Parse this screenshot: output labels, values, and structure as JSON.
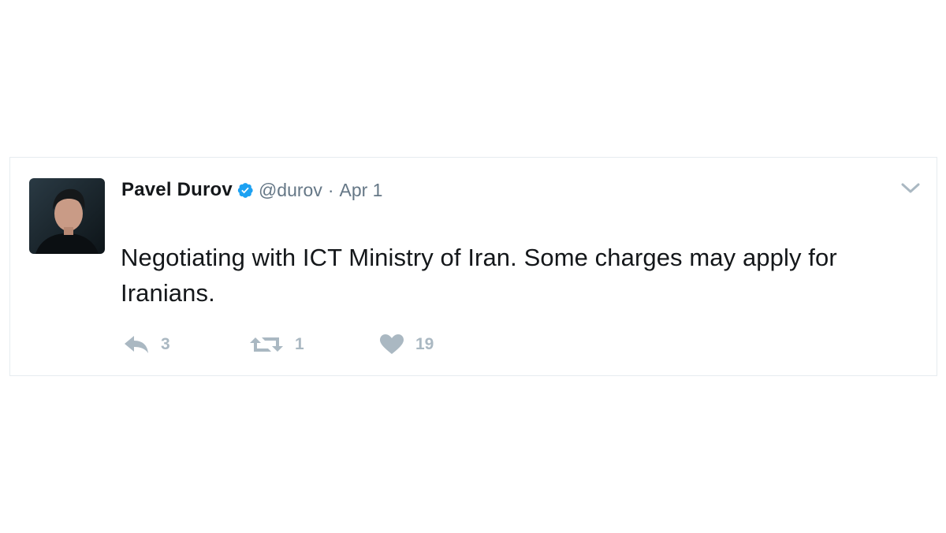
{
  "tweet": {
    "author_name": "Pavel Durov",
    "handle": "@durov",
    "separator": "·",
    "date": "Apr 1",
    "verified": true,
    "text": "Negotiating with ICT Ministry of Iran. Some charges may apply for Iranians.",
    "actions": {
      "reply_count": "3",
      "retweet_count": "1",
      "like_count": "19"
    }
  },
  "icons": {
    "verified": "verified-badge-icon",
    "menu": "chevron-down-icon",
    "reply": "reply-icon",
    "retweet": "retweet-icon",
    "like": "heart-icon"
  },
  "colors": {
    "verified_blue": "#1da1f2",
    "action_gray": "#aab8c2",
    "secondary_text": "#657786",
    "border": "#e6ecf0"
  }
}
